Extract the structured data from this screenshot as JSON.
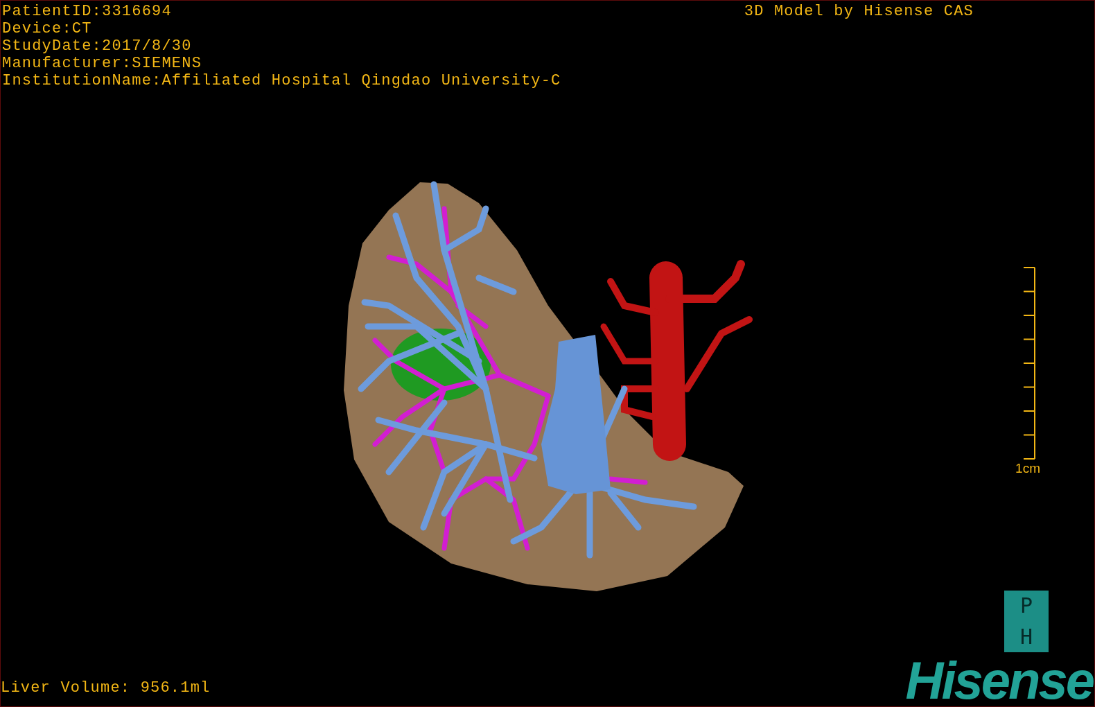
{
  "header_lines": [
    "PatientID:3316694",
    "Device:CT",
    "StudyDate:2017/8/30",
    "Manufacturer:SIEMENS",
    "InstitutionName:Affiliated Hospital Qingdao University-C"
  ],
  "title": "3D Model by Hisense CAS",
  "scale_bar": {
    "label": "1cm"
  },
  "liver_volume": "Liver Volume: 956.1ml",
  "logo": {
    "badge_letters": [
      "P",
      "H"
    ],
    "wordmark": "Hisense"
  }
}
